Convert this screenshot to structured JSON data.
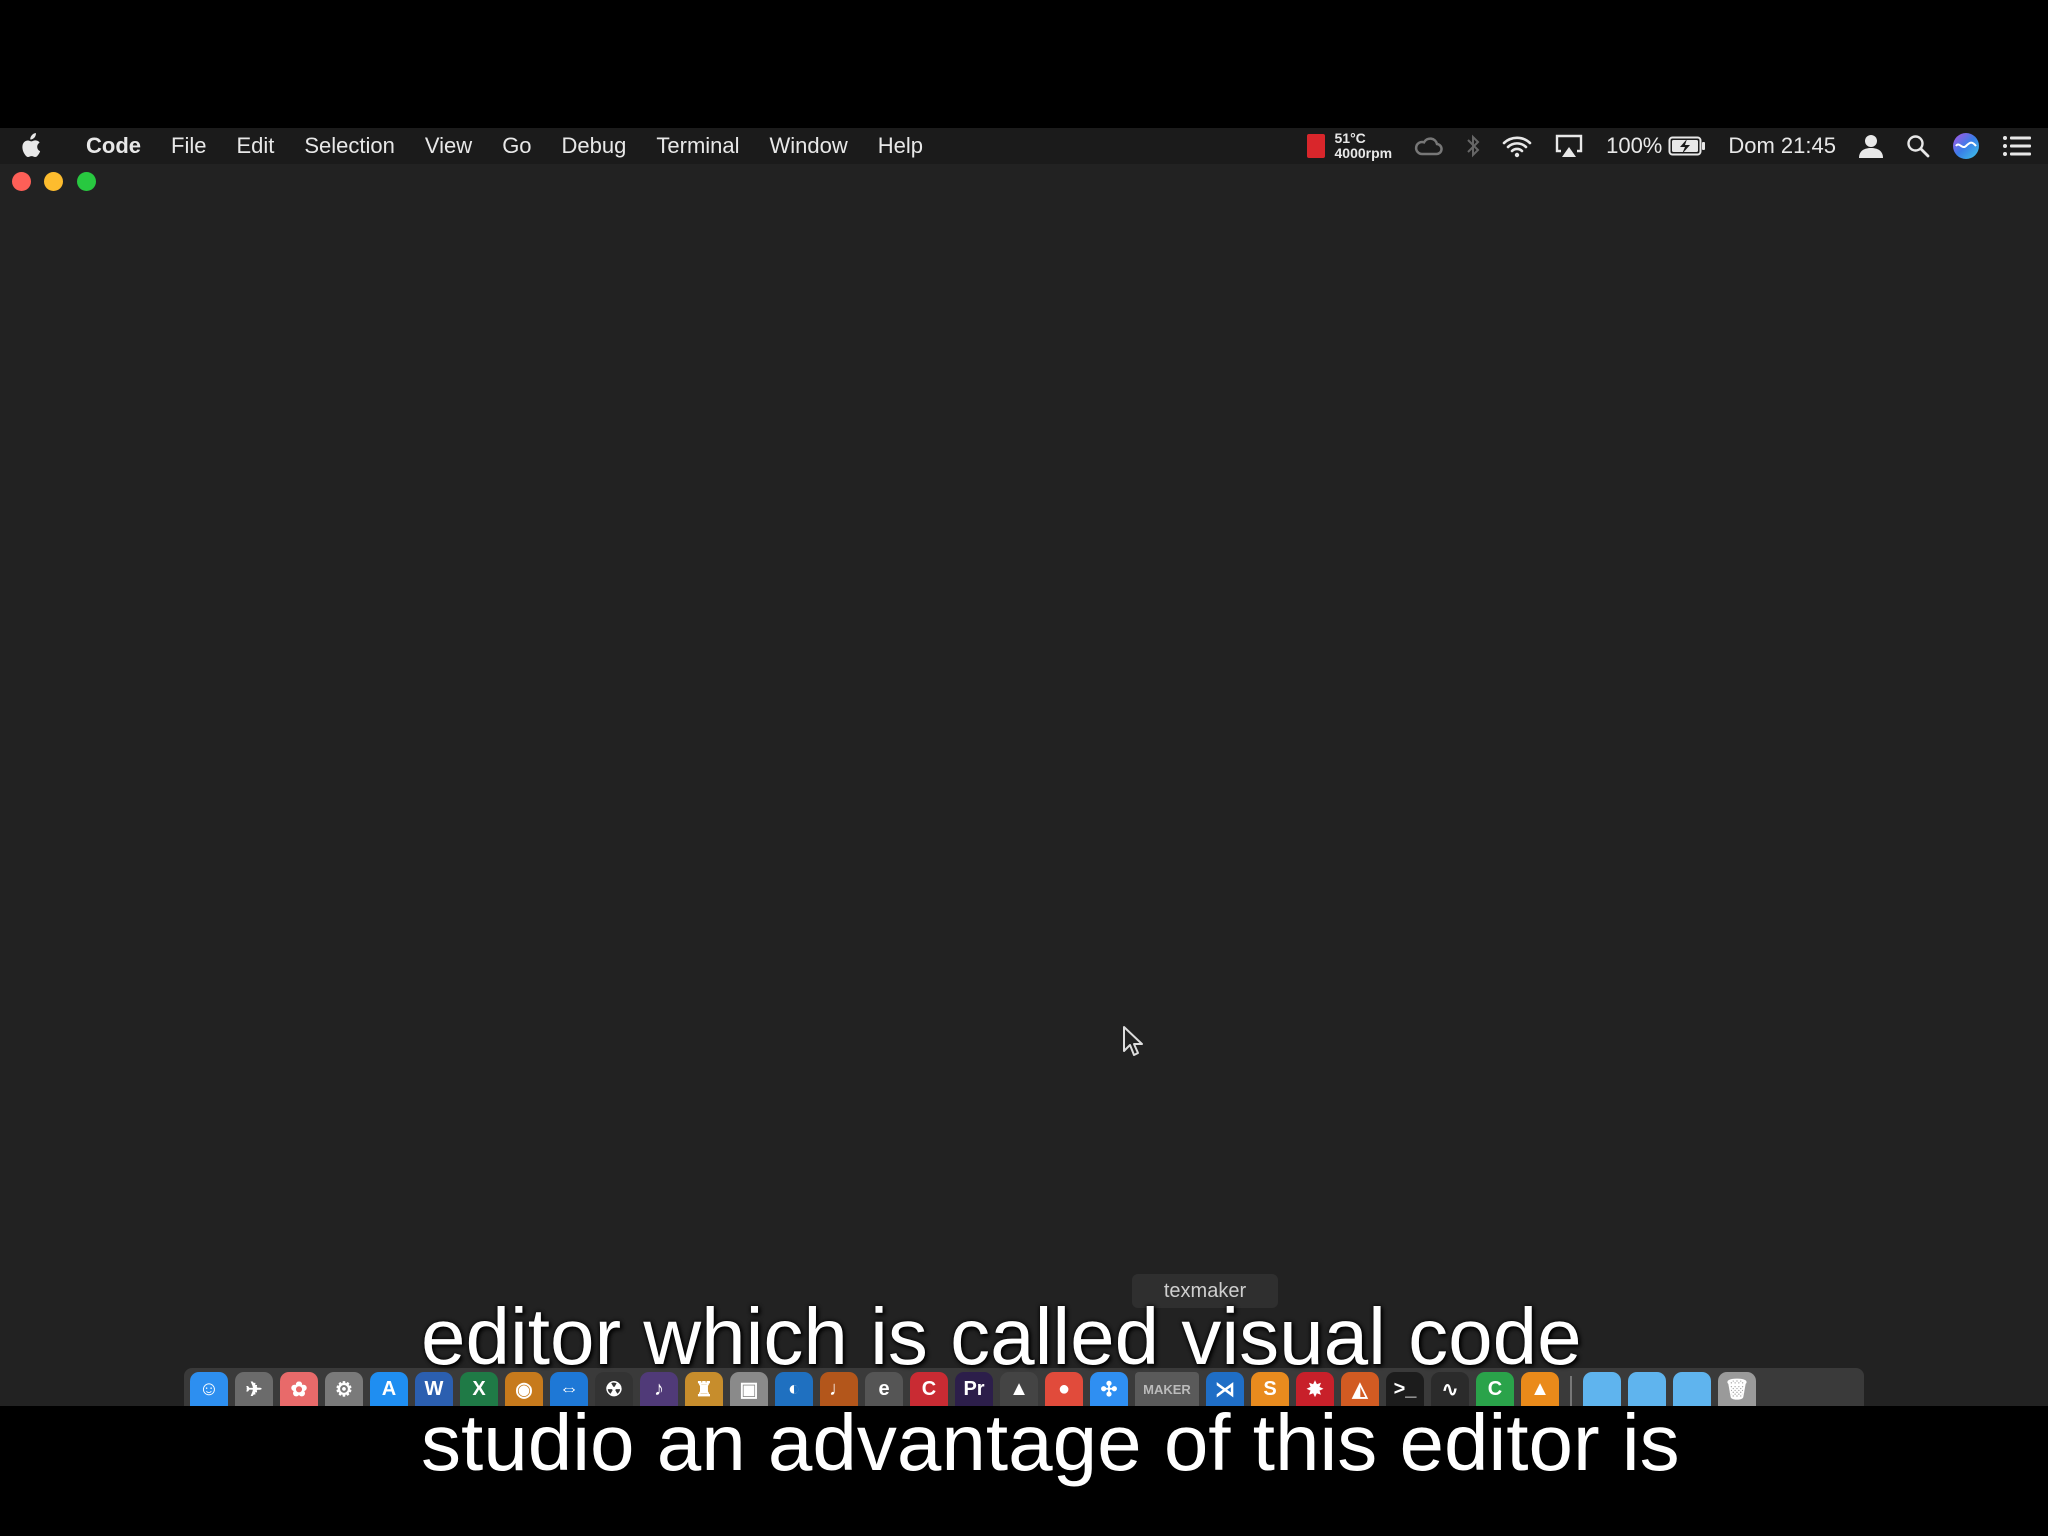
{
  "menubar": {
    "app_name": "Code",
    "menus": [
      "File",
      "Edit",
      "Selection",
      "View",
      "Go",
      "Debug",
      "Terminal",
      "Window",
      "Help"
    ],
    "status": {
      "temperature": "51°C",
      "fan_speed": "4000rpm",
      "battery": "100%",
      "clock": "Dom 21:45"
    }
  },
  "dock": {
    "tooltip": "texmaker",
    "texmaker_label": "MAKER",
    "icons": [
      {
        "name": "finder",
        "color": "#2d8ff0",
        "glyph": "☺"
      },
      {
        "name": "launchpad",
        "color": "#6b6b6b",
        "glyph": "✈"
      },
      {
        "name": "photos",
        "color": "#e86a6a",
        "glyph": "✿"
      },
      {
        "name": "system-preferences",
        "color": "#7a7a7a",
        "glyph": "⚙"
      },
      {
        "name": "app-store",
        "color": "#1f8ef1",
        "glyph": "A"
      },
      {
        "name": "word",
        "color": "#2b5fb0",
        "glyph": "W"
      },
      {
        "name": "excel",
        "color": "#1f7a46",
        "glyph": "X"
      },
      {
        "name": "music",
        "color": "#c77a1c",
        "glyph": "◉"
      },
      {
        "name": "teamviewer",
        "color": "#1e78d6",
        "glyph": "⇔"
      },
      {
        "name": "radiation-app",
        "color": "#333333",
        "glyph": "☢"
      },
      {
        "name": "audio-app",
        "color": "#503a78",
        "glyph": "♪"
      },
      {
        "name": "contacts",
        "color": "#c78d2c",
        "glyph": "♜"
      },
      {
        "name": "utility-app",
        "color": "#8a8a8a",
        "glyph": "▣"
      },
      {
        "name": "circle-app",
        "color": "#1f70c0",
        "glyph": "◐"
      },
      {
        "name": "guitar-app",
        "color": "#b3561b",
        "glyph": "♩"
      },
      {
        "name": "eclipse",
        "color": "#555555",
        "glyph": "e"
      },
      {
        "name": "codeblocks",
        "color": "#c92b33",
        "glyph": "C"
      },
      {
        "name": "premiere",
        "color": "#2c1e4a",
        "glyph": "Pr"
      },
      {
        "name": "inkscape",
        "color": "#444444",
        "glyph": "▲"
      },
      {
        "name": "chrome",
        "color": "#e14b3b",
        "glyph": "●"
      },
      {
        "name": "safari",
        "color": "#2f8ff2",
        "glyph": "✣"
      }
    ],
    "icons_right": [
      {
        "name": "vscode",
        "color": "#1f6ec6",
        "glyph": "⋊"
      },
      {
        "name": "sublime",
        "color": "#e98b1e",
        "glyph": "S"
      },
      {
        "name": "mathematica",
        "color": "#c8202a",
        "glyph": "✸"
      },
      {
        "name": "matlab",
        "color": "#d25b22",
        "glyph": "◭"
      },
      {
        "name": "terminal",
        "color": "#1c1c1c",
        "glyph": ">_"
      },
      {
        "name": "activity-monitor",
        "color": "#2b2b2b",
        "glyph": "∿"
      },
      {
        "name": "camtasia",
        "color": "#2aa34a",
        "glyph": "C"
      },
      {
        "name": "vlc",
        "color": "#ea8a1a",
        "glyph": "▲"
      }
    ],
    "folders": [
      {
        "name": "folder",
        "color": "#5fb4ee",
        "glyph": ""
      },
      {
        "name": "folder",
        "color": "#5fb4ee",
        "glyph": ""
      },
      {
        "name": "folder",
        "color": "#5fb4ee",
        "glyph": ""
      },
      {
        "name": "trash",
        "color": "#9a9a9a",
        "glyph": "🗑"
      }
    ]
  },
  "subtitles": {
    "line1": "editor which is called visual code",
    "line2": "studio an advantage of this editor is"
  }
}
